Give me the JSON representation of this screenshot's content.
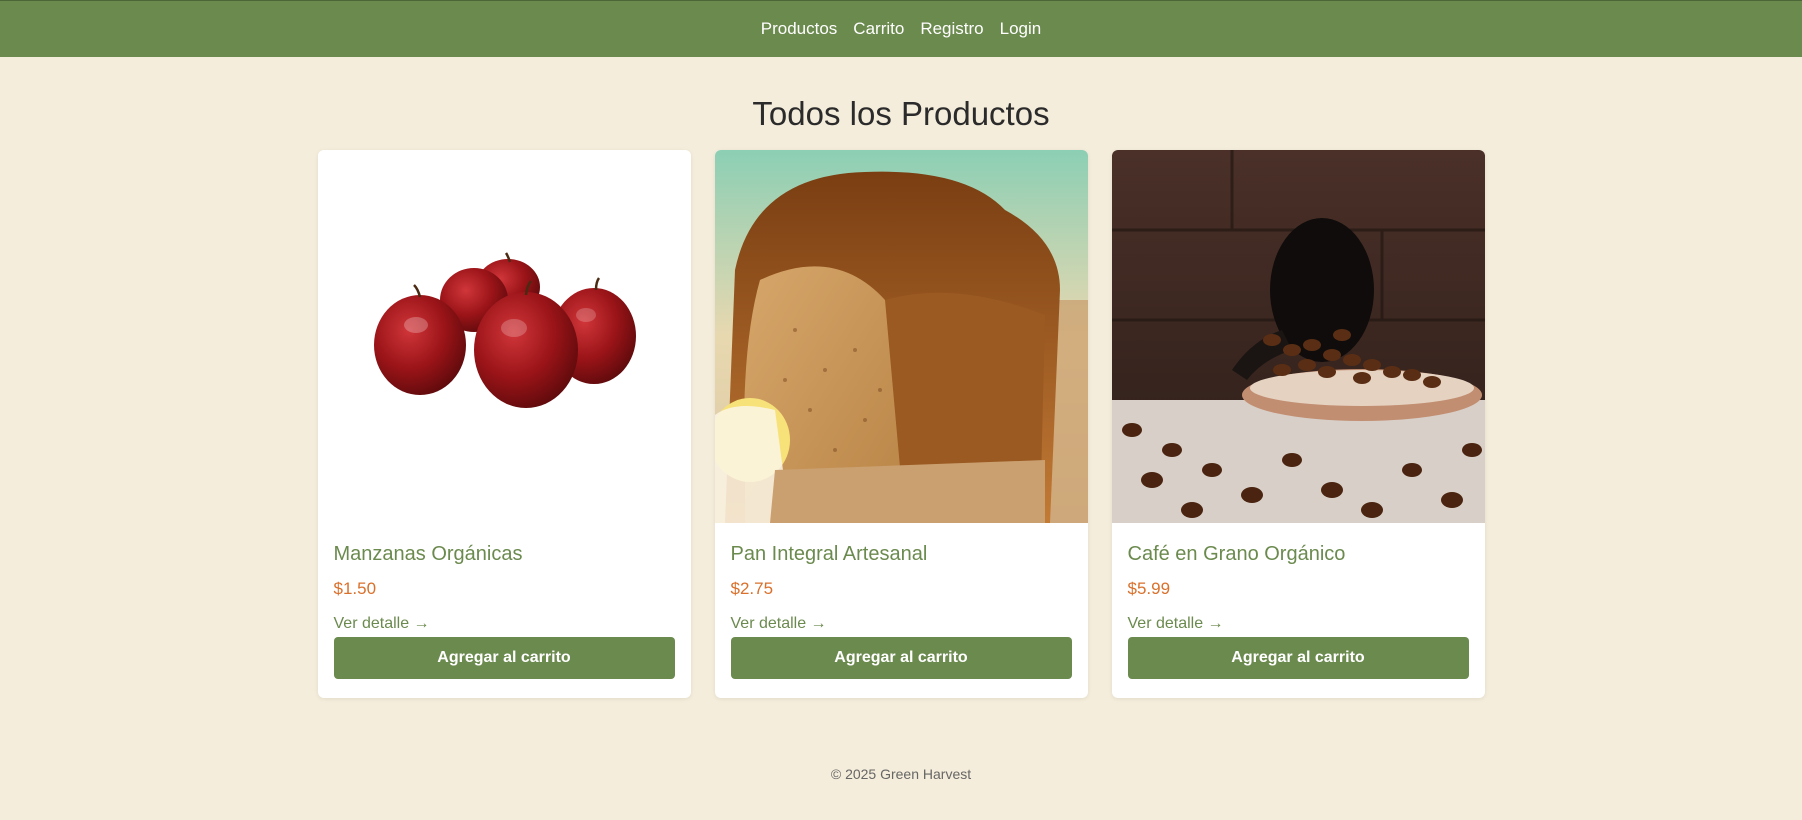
{
  "nav": {
    "items": [
      "Productos",
      "Carrito",
      "Registro",
      "Login"
    ]
  },
  "main": {
    "title": "Todos los Productos",
    "products": [
      {
        "name": "Manzanas Orgánicas",
        "price": "$1.50",
        "link": "Ver detalle →",
        "button": "Agregar al carrito",
        "image": "red-apples"
      },
      {
        "name": "Pan Integral Artesanal",
        "price": "$2.75",
        "link": "Ver detalle →",
        "button": "Agregar al carrito",
        "image": "whole-wheat-bread"
      },
      {
        "name": "Café en Grano Orgánico",
        "price": "$5.99",
        "link": "Ver detalle →",
        "button": "Agregar al carrito",
        "image": "coffee-beans"
      }
    ]
  },
  "footer": {
    "text": "© 2025 Green Harvest"
  },
  "colors": {
    "nav_bg": "#6b8a4e",
    "page_bg": "#f5eddb",
    "price": "#d9702b",
    "accent": "#6b8a4e"
  }
}
